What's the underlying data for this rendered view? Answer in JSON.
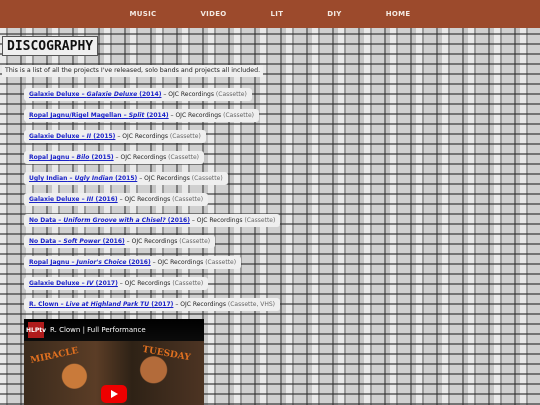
{
  "nav": {
    "items": [
      {
        "label": "MUSIC"
      },
      {
        "label": "VIDEO"
      },
      {
        "label": "LIT"
      },
      {
        "label": "DIY"
      },
      {
        "label": "HOME"
      }
    ]
  },
  "page": {
    "title": "DISCOGRAPHY",
    "intro": "This is a list of all the projects I've released, solo bands and projects all included."
  },
  "releases": [
    {
      "artist": "Galaxie Deluxe",
      "title": "Galaxie Deluxe",
      "year": "(2014)",
      "label": "OJC Recordings",
      "format": "(Cassette)"
    },
    {
      "artist": "Ropal Jagnu/Rigel Magellan",
      "title": "Split",
      "year": "(2014)",
      "label": "OJC Recordings",
      "format": "(Cassette)"
    },
    {
      "artist": "Galaxie Deluxe",
      "title": "II",
      "year": "(2015)",
      "label": "OJC Recordings",
      "format": "(Cassette)"
    },
    {
      "artist": "Ropal Jagnu",
      "title": "Bilo",
      "year": "(2015)",
      "label": "OJC Recordings",
      "format": "(Cassette)"
    },
    {
      "artist": "Ugly Indian",
      "title": "Ugly Indian",
      "year": "(2015)",
      "label": "OJC Recordings",
      "format": "(Cassette)"
    },
    {
      "artist": "Galaxie Deluxe",
      "title": "III",
      "year": "(2016)",
      "label": "OJC Recordings",
      "format": "(Cassette)"
    },
    {
      "artist": "No Data",
      "title": "Uniform Groove with a Chisel?",
      "year": "(2016)",
      "label": "OJC Recordings",
      "format": "(Cassette)"
    },
    {
      "artist": "No Data",
      "title": "Soft Power",
      "year": "(2016)",
      "label": "OJC Recordings",
      "format": "(Cassette)"
    },
    {
      "artist": "Ropal Jagnu",
      "title": "Junior's Choice",
      "year": "(2016)",
      "label": "OJC Recordings",
      "format": "(Cassette)"
    },
    {
      "artist": "Galaxie Deluxe",
      "title": "IV",
      "year": "(2017)",
      "label": "OJC Recordings",
      "format": "(Cassette)"
    },
    {
      "artist": "R. Clown",
      "title": "Live at Highland Park TU",
      "year": "(2017)",
      "label": "OJC Recordings",
      "format": "(Cassette, VHS)"
    }
  ],
  "video": {
    "logo": "HLPtv",
    "title": "R. Clown | Full Performance",
    "overlay_left": "MIRACLE",
    "overlay_right": "TUESDAY"
  },
  "colors": {
    "topbar": "#9c4a2c",
    "link": "#1a22c8",
    "youtube_red": "#e00000"
  }
}
